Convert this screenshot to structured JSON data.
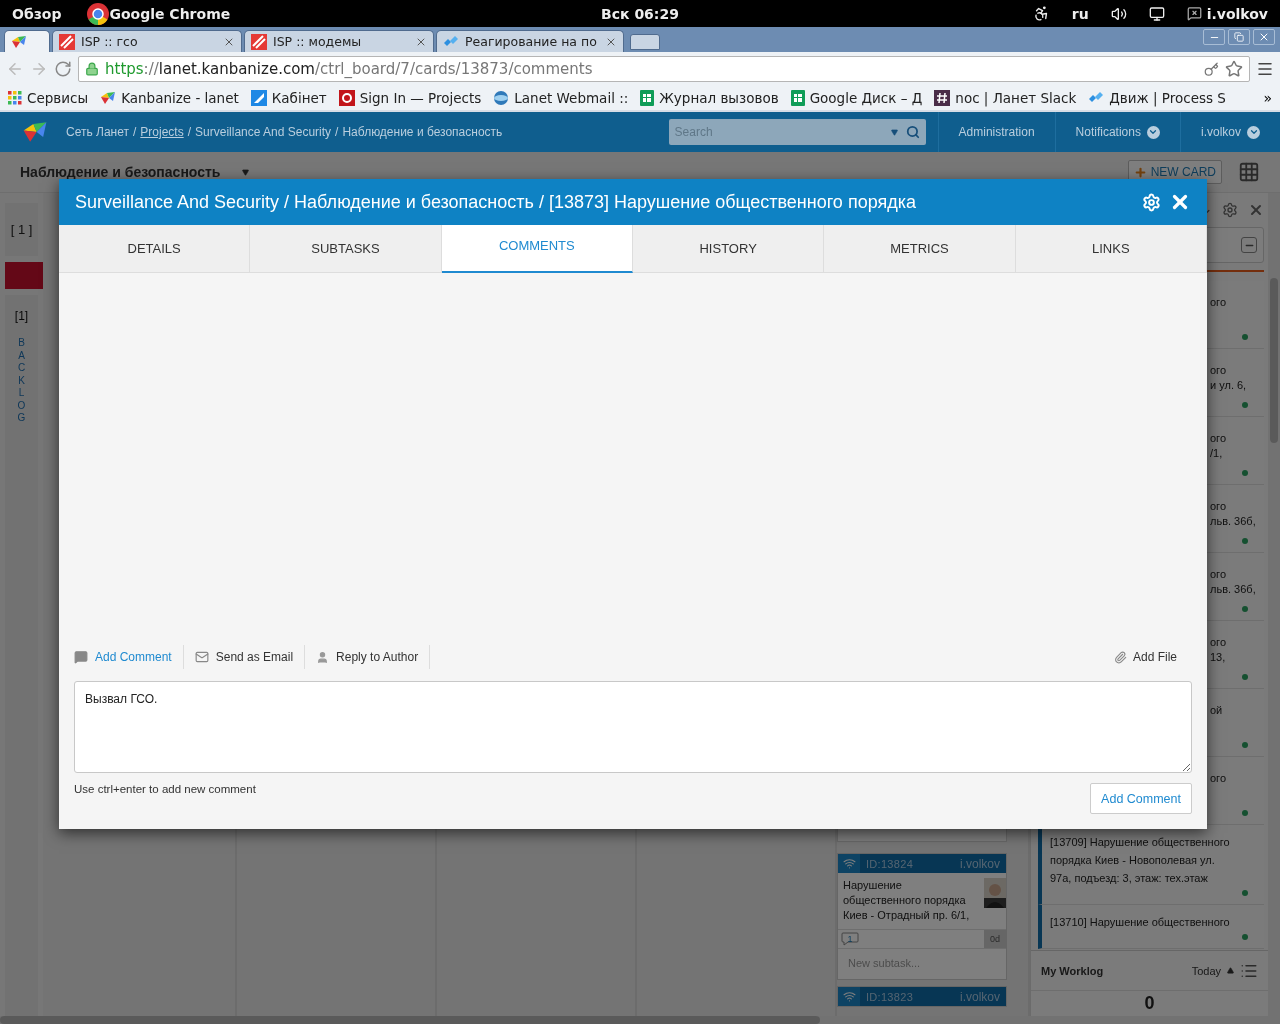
{
  "system_bar": {
    "activities": "Обзор",
    "app_name": "Google Chrome",
    "clock": "Вск 06:29",
    "language": "ru",
    "user": "i.volkov"
  },
  "browser": {
    "tabs": [
      {
        "kind": "pinned",
        "selected": true
      },
      {
        "kind": "isp",
        "title": "ISP :: гсо",
        "selected": false
      },
      {
        "kind": "isp",
        "title": "ISP :: модемы",
        "selected": false
      },
      {
        "kind": "kanbanize",
        "title": "Реагирование на по",
        "selected": false
      }
    ],
    "address": [
      {
        "kind": "scheme",
        "text": "https"
      },
      {
        "kind": "muted",
        "text": "://"
      },
      {
        "kind": "host",
        "text": "lanet.kanbanize.com"
      },
      {
        "kind": "muted",
        "text": "/ctrl_board/7/cards/13873/comments"
      }
    ],
    "bookmarks": [
      {
        "kind": "apps",
        "title": "Сервисы"
      },
      {
        "kind": "kanbanize",
        "title": "Kanbanize - lanet"
      },
      {
        "kind": "cabinet",
        "title": "Кабінет"
      },
      {
        "kind": "oc",
        "title": "Sign In — Projects"
      },
      {
        "kind": "webmail",
        "title": "Lanet Webmail ::"
      },
      {
        "kind": "sheet",
        "title": "Журнал вызовов"
      },
      {
        "kind": "sheet",
        "title": "Google Диск – Д"
      },
      {
        "kind": "slack",
        "title": "noc | Ланет Slack"
      },
      {
        "kind": "dvizh",
        "title": "Движ | Process S"
      }
    ],
    "bookmarks_more": "»"
  },
  "app_header": {
    "breadcrumb": [
      {
        "kind": "text",
        "text": "Сеть Ланет"
      },
      {
        "kind": "separator",
        "text": "/"
      },
      {
        "kind": "link",
        "text": "Projects"
      },
      {
        "kind": "separator",
        "text": "/"
      },
      {
        "kind": "text",
        "text": "Surveillance And Security"
      },
      {
        "kind": "separator",
        "text": "/"
      },
      {
        "kind": "text",
        "text": "Наблюдение и безопасность"
      }
    ],
    "search_placeholder": "Search",
    "nav": [
      {
        "label": "Administration",
        "dropdown": false
      },
      {
        "label": "Notifications",
        "dropdown": true
      },
      {
        "label": "i.volkov",
        "dropdown": true
      }
    ]
  },
  "board": {
    "title": "Наблюдение и безопасность",
    "new_card": "NEW CARD",
    "backlog": {
      "column_wip": "[ 1 ]",
      "lane_wip": "[1]",
      "lane_title": "BACKLOG"
    },
    "cards": [
      {
        "id": "ID:13824",
        "owner": "i.volkov",
        "title": "Нарушение общественного порядка Киев - Отрадный пр. 6/1,",
        "comments": "1",
        "age": "0d",
        "subtask_placeholder": "New subtask..."
      },
      {
        "id": "ID:13823",
        "owner": "i.volkov"
      }
    ],
    "side_panel": {
      "card_fragments": [
        "ого",
        "ого\nи ул. 6,",
        "ого\n/1,",
        "ого\nльв. 36б,",
        "ого\nльв. 36б,",
        "ого\n13,",
        "ой",
        "ого"
      ],
      "cards": [
        "[13709] Нарушение общественного порядка Киев - Новополевая ул. 97а, подъезд: 3, этаж: тех.этаж",
        "[13710] Нарушение общественного"
      ],
      "worklog": {
        "title": "My Worklog",
        "period": "Today",
        "total": "0"
      }
    }
  },
  "modal": {
    "title": "Surveillance And Security / Наблюдение и безопасность / [13873] Нарушение общественного порядка",
    "tabs": [
      {
        "label": "DETAILS",
        "selected": false
      },
      {
        "label": "SUBTASKS",
        "selected": false
      },
      {
        "label": "COMMENTS",
        "selected": true
      },
      {
        "label": "HISTORY",
        "selected": false
      },
      {
        "label": "METRICS",
        "selected": false
      },
      {
        "label": "LINKS",
        "selected": false
      }
    ],
    "actions": [
      {
        "kind": "comment",
        "label": "Add Comment",
        "selected": true
      },
      {
        "kind": "email",
        "label": "Send as Email",
        "selected": false
      },
      {
        "kind": "reply",
        "label": "Reply to Author",
        "selected": false
      }
    ],
    "add_file": "Add File",
    "comment": "Вызвал ГСО.",
    "hint": "Use ctrl+enter to add new comment",
    "submit": "Add Comment"
  }
}
